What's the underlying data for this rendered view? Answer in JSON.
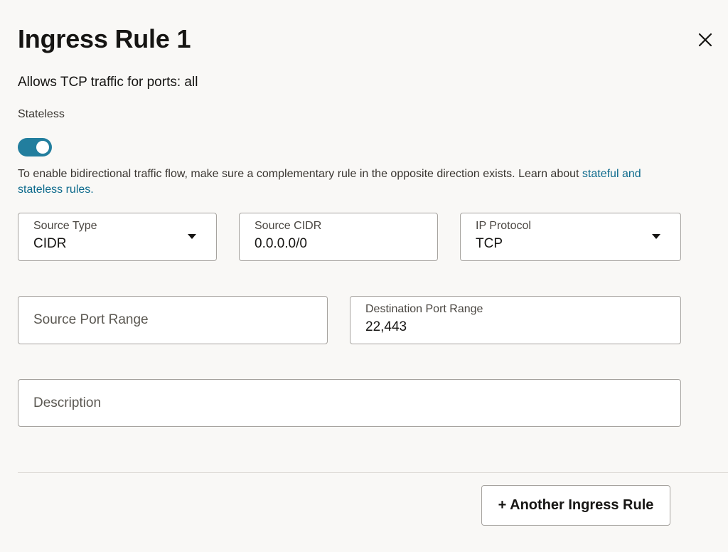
{
  "header": {
    "title": "Ingress Rule 1",
    "close_icon": "close-icon"
  },
  "summary": "Allows TCP traffic for ports: all",
  "stateless": {
    "label": "Stateless",
    "enabled": true,
    "accent_color": "#227e9e"
  },
  "help": {
    "text": "To enable bidirectional traffic flow, make sure a complementary rule in the opposite direction exists. Learn about ",
    "link_text": "stateful and stateless rules."
  },
  "fields": {
    "source_type": {
      "label": "Source Type",
      "value": "CIDR"
    },
    "source_cidr": {
      "label": "Source CIDR",
      "value": "0.0.0.0/0"
    },
    "ip_protocol": {
      "label": "IP Protocol",
      "value": "TCP"
    },
    "source_port_range": {
      "placeholder": "Source Port Range",
      "value": ""
    },
    "destination_port_range": {
      "label": "Destination Port Range",
      "value": "22,443"
    },
    "description": {
      "placeholder": "Description",
      "value": ""
    }
  },
  "footer": {
    "add_button_label": "+ Another Ingress Rule"
  }
}
